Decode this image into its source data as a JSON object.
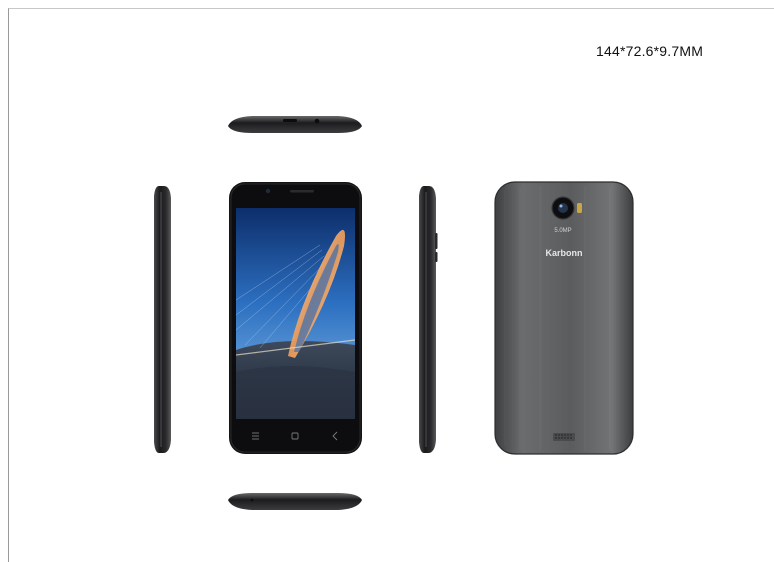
{
  "dimensions_label": "144*72.6*9.7MM",
  "camera_label": "5.0MP",
  "brand": "Karbonn",
  "colors": {
    "body_dark": "#1b1b1d",
    "back_gray": "#5d5f61",
    "screen_blue": "#1e4f96"
  },
  "icons": [
    "menu-icon",
    "home-icon",
    "back-icon"
  ]
}
